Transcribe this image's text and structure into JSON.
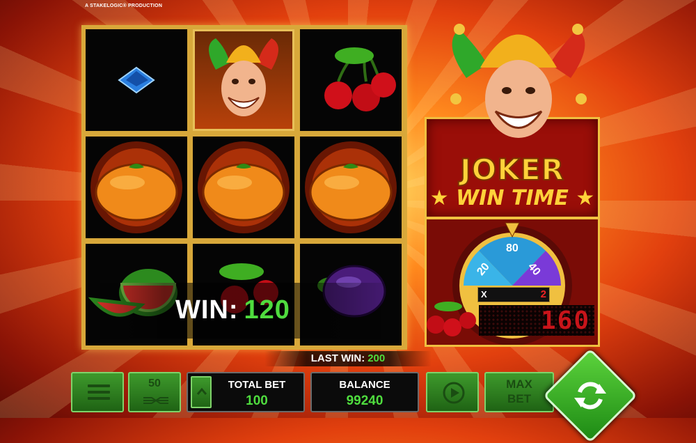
{
  "producer": "A STAKELOGIC® PRODUCTION",
  "reels": {
    "symbols": [
      [
        "diamond-blue",
        "joker",
        "cherries"
      ],
      [
        "orange-fire",
        "orange-fire",
        "orange-fire"
      ],
      [
        "watermelon",
        "cherries",
        "plum"
      ]
    ]
  },
  "win_banner": {
    "label": "WIN:",
    "value": "120"
  },
  "logo": {
    "title": "JOKER",
    "subtitle": "WIN TIME"
  },
  "wheel": {
    "segments": [
      "80",
      "40",
      "20"
    ],
    "multiplier_prefix": "X",
    "multiplier_value": "2"
  },
  "led_display": {
    "value": "160"
  },
  "last_win": {
    "label": "LAST WIN:",
    "value": "200"
  },
  "controls": {
    "lines": "50",
    "total_bet_label": "TOTAL BET",
    "total_bet_value": "100",
    "balance_label": "BALANCE",
    "balance_value": "99240",
    "max_bet_line1": "MAX",
    "max_bet_line2": "BET"
  },
  "colors": {
    "accent_green": "#4fdc3e",
    "gold": "#f0c040",
    "led_red": "#c8141a"
  }
}
